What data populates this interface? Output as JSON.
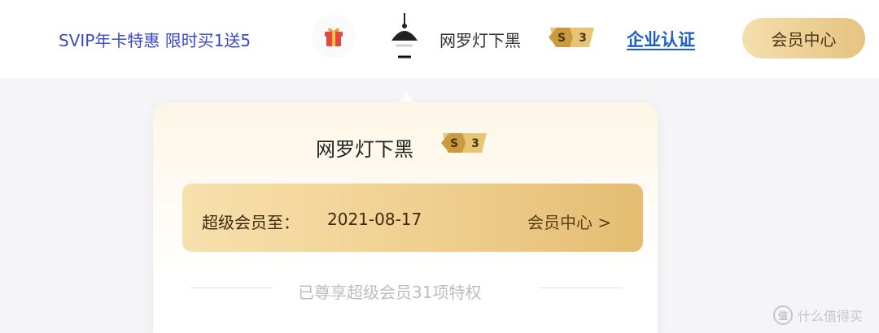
{
  "header": {
    "promo_text": "SVIP年卡特惠 限时买1送5",
    "username": "网罗灯下黑",
    "level_badge": {
      "letter": "S",
      "number": "3"
    },
    "enterprise_link": "企业认证",
    "member_center_button": "会员中心"
  },
  "dropdown": {
    "username": "网罗灯下黑",
    "level_badge": {
      "letter": "S",
      "number": "3"
    },
    "vip_label": "超级会员至：",
    "vip_expiry": "2021-08-17",
    "member_center_link": "会员中心 >",
    "privilege_text": "已尊享超级会员31项特权"
  },
  "watermark": {
    "icon_glyph": "值",
    "text": "什么值得买"
  },
  "colors": {
    "promo": "#3949c8",
    "enterprise": "#1c5fc4",
    "gold_start": "#f7e0ad",
    "gold_end": "#e4bc72"
  }
}
